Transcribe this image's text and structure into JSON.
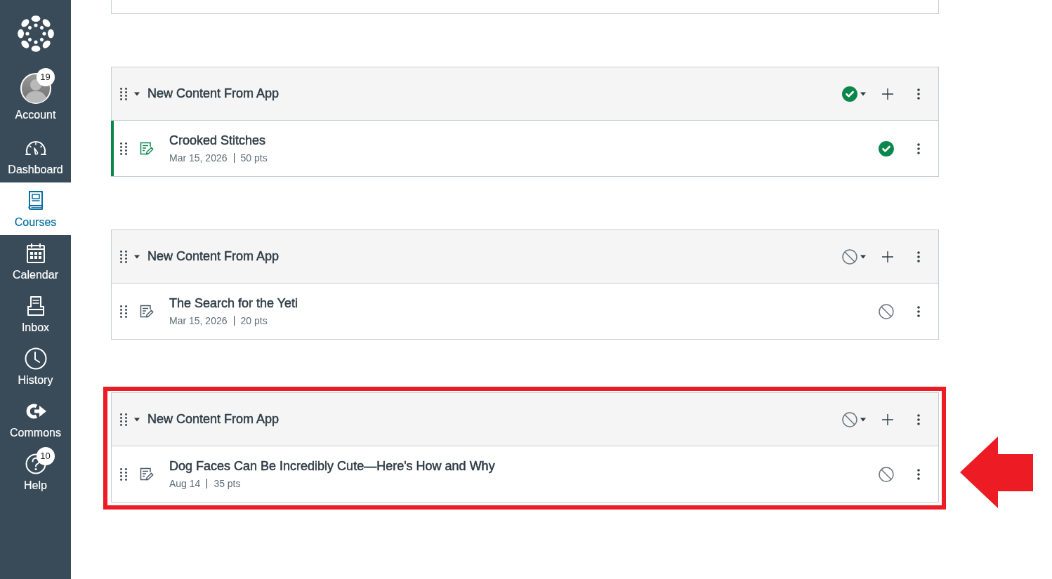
{
  "sidebar": {
    "items": [
      {
        "kind": "account",
        "label": "Account",
        "badge": "19",
        "selected": false
      },
      {
        "kind": "dashboard",
        "label": "Dashboard",
        "selected": false
      },
      {
        "kind": "courses",
        "label": "Courses",
        "selected": true
      },
      {
        "kind": "calendar",
        "label": "Calendar",
        "selected": false
      },
      {
        "kind": "inbox",
        "label": "Inbox",
        "selected": false
      },
      {
        "kind": "history",
        "label": "History",
        "selected": false
      },
      {
        "kind": "commons",
        "label": "Commons",
        "selected": false
      },
      {
        "kind": "help",
        "label": "Help",
        "badge": "10",
        "selected": false
      }
    ]
  },
  "modules": [
    {
      "title": "New Content From App",
      "expanded": true,
      "published": true,
      "highlighted": false,
      "items": [
        {
          "title": "Crooked Stitches",
          "date": "Mar 15, 2026",
          "points": "50 pts",
          "published": true
        }
      ]
    },
    {
      "title": "New Content From App",
      "expanded": true,
      "published": false,
      "highlighted": false,
      "items": [
        {
          "title": "The Search for the Yeti",
          "date": "Mar 15, 2026",
          "points": "20 pts",
          "published": false
        }
      ]
    },
    {
      "title": "New Content From App",
      "expanded": true,
      "published": false,
      "highlighted": true,
      "items": [
        {
          "title": "Dog Faces Can Be Incredibly Cute—Here's How and Why",
          "date": "Aug 14",
          "points": "35 pts",
          "published": false
        }
      ]
    }
  ]
}
